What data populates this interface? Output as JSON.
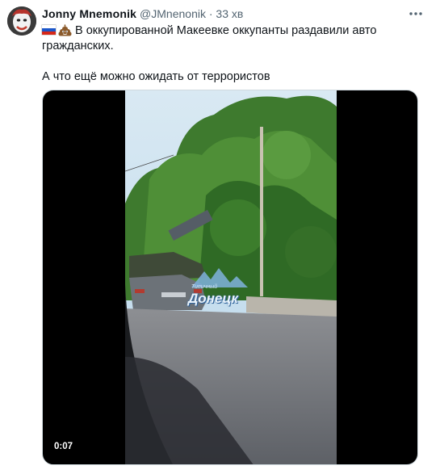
{
  "tweet": {
    "author_name": "Jonny Mnemonik",
    "author_handle": "@JMnenonik",
    "separator": "·",
    "time": "33 хв",
    "line1": "В оккупированной Макеевке оккупанты раздавили авто",
    "line2": "гражданских.",
    "line3": "А что ещё можно ожидать от террористов"
  },
  "media": {
    "duration": "0:07",
    "watermark_top": "Типичный",
    "watermark_main": "Донецк"
  },
  "icons": {
    "flag": "russia-flag-icon",
    "emoji": "poop-emoji-icon",
    "more": "more-options-icon"
  }
}
